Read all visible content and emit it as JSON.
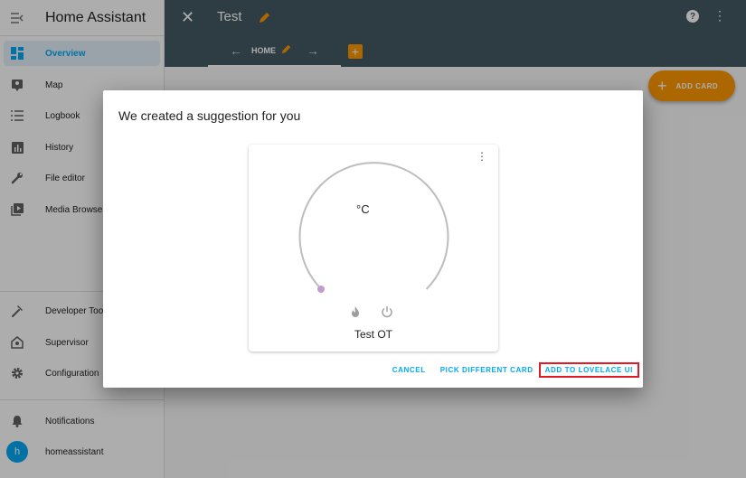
{
  "app": {
    "title": "Home Assistant"
  },
  "sidebar": {
    "items": [
      {
        "label": "Overview",
        "icon": "dashboard-icon",
        "active": true
      },
      {
        "label": "Map",
        "icon": "map-icon"
      },
      {
        "label": "Logbook",
        "icon": "logbook-icon"
      },
      {
        "label": "History",
        "icon": "history-icon"
      },
      {
        "label": "File editor",
        "icon": "wrench-icon"
      },
      {
        "label": "Media Browser",
        "icon": "media-icon"
      }
    ],
    "bottom_items": [
      {
        "label": "Developer Tools",
        "icon": "hammer-icon"
      },
      {
        "label": "Supervisor",
        "icon": "supervisor-icon"
      },
      {
        "label": "Configuration",
        "icon": "gear-icon"
      }
    ],
    "notifications_label": "Notifications",
    "user": {
      "initial": "h",
      "name": "homeassistant"
    }
  },
  "header": {
    "title": "Test",
    "tab_label": "HOME",
    "help_glyph": "?"
  },
  "fab": {
    "label": "ADD CARD"
  },
  "dialog": {
    "title": "We created a suggestion for you",
    "card": {
      "unit": "°C",
      "name": "Test OT"
    },
    "actions": {
      "cancel": "CANCEL",
      "pick": "PICK DIFFERENT CARD",
      "add": "ADD TO LOVELACE UI"
    }
  },
  "colors": {
    "accent": "#03a9f4",
    "header": "#455a64",
    "orange": "#ff9800",
    "highlight": "#e01b24"
  }
}
